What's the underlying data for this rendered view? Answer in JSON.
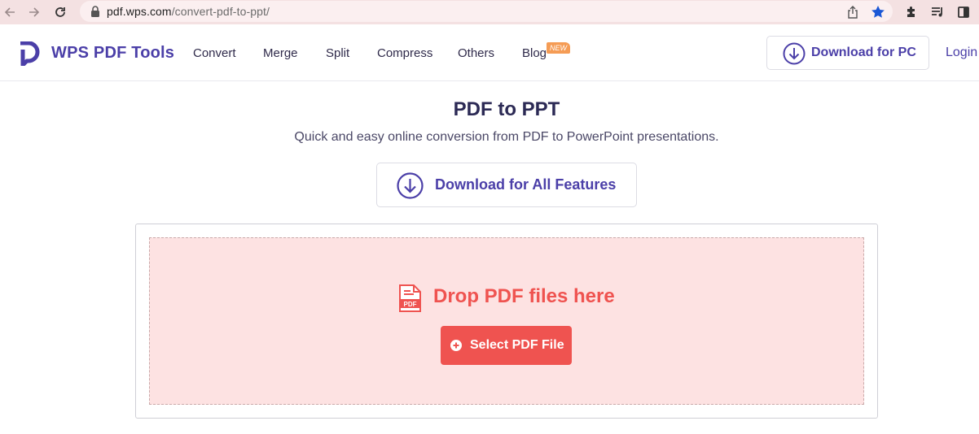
{
  "browser": {
    "url_host": "pdf.wps.com",
    "url_path": "/convert-pdf-to-ppt/",
    "icons": [
      "back-icon",
      "forward-icon",
      "reload-icon",
      "lock-icon",
      "share-icon",
      "bookmark-star-icon",
      "extensions-icon",
      "reading-list-icon",
      "sidebar-icon"
    ]
  },
  "header": {
    "logo_text": "WPS PDF Tools",
    "nav": [
      "Convert",
      "Merge",
      "Split",
      "Compress",
      "Others",
      "Blog"
    ],
    "new_badge": "NEW",
    "download_pc_label": "Download for PC",
    "login_label": "Login"
  },
  "main": {
    "title": "PDF to PPT",
    "subtitle": "Quick and easy online conversion from PDF to PowerPoint presentations.",
    "download_all_label": "Download for All Features",
    "drop_text": "Drop PDF files here",
    "select_button_label": "Select PDF File",
    "pdf_icon_text": "PDF"
  },
  "colors": {
    "brand_purple": "#4b3fa8",
    "accent_red": "#ef5350",
    "drop_zone_bg": "#fde2e2",
    "browser_bar": "#f4e1e2",
    "badge_orange": "#f59c55"
  }
}
